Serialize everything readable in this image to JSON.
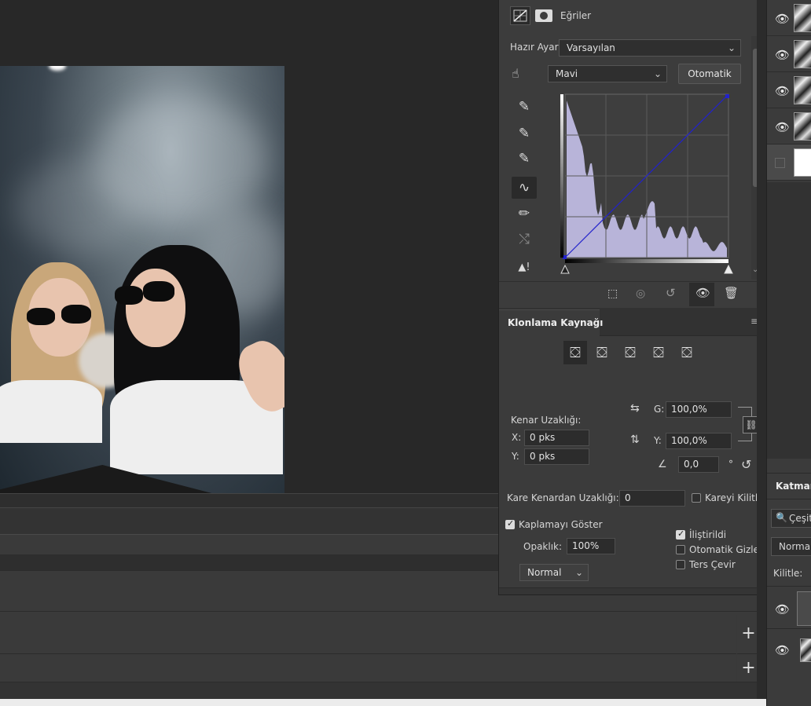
{
  "curves": {
    "title": "Eğriler",
    "preset_label": "Hazır Ayar:",
    "preset_value": "Varsayılan",
    "channel_value": "Mavi",
    "auto_button": "Otomatik"
  },
  "clone_source": {
    "tab_label": "Klonlama Kaynağı",
    "offset_label": "Kenar Uzaklığı:",
    "x_label": "X:",
    "x_value": "0 pks",
    "y_label": "Y:",
    "y_value": "0 pks",
    "width_label": "G:",
    "width_value": "100,0%",
    "height_label": "Y:",
    "height_value": "100,0%",
    "angle_value": "0,0",
    "degree_symbol": "°",
    "frame_offset_label": "Kare Kenardan Uzaklığı:",
    "frame_offset_value": "0",
    "lock_frame_label": "Kareyi Kilitle",
    "show_overlay_label": "Kaplamayı Göster",
    "opacity_label": "Opaklık:",
    "opacity_value": "100%",
    "blend_mode_value": "Normal",
    "clipped_label": "İliştirildi",
    "auto_hide_label": "Otomatik Gizle",
    "invert_label": "Ters Çevir"
  },
  "layers": {
    "tab_label": "Katman",
    "filter_label": "Çeşit",
    "blend_mode_value": "Normal",
    "lock_label": "Kilitle:"
  },
  "timeline": {
    "add_symbol": "+"
  },
  "colors": {
    "histogram": "#b8b4d9",
    "curve_line": "#2222cc"
  }
}
